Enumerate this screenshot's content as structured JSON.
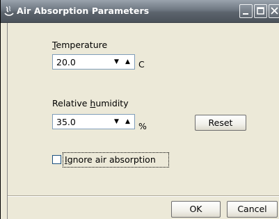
{
  "window": {
    "title": "Air Absorption Parameters",
    "icon": "java-cup-icon",
    "controls": [
      "minimize-icon",
      "maximize-icon",
      "close-icon"
    ]
  },
  "temperature": {
    "label_first": "T",
    "label_rest": "emperature",
    "value": "20.0",
    "unit": "C"
  },
  "humidity": {
    "label_pre": "Relative ",
    "label_mn": "h",
    "label_post": "umidity",
    "value": "35.0",
    "unit": "%"
  },
  "reset_label": "Reset",
  "ignore": {
    "mn": "I",
    "rest": "gnore air absorption",
    "checked": false
  },
  "ok_label": "OK",
  "cancel_label": "Cancel",
  "arrows": {
    "down": "▼",
    "up": "▲"
  },
  "colors": {
    "titlebar": "#6e7781",
    "dialog_bg": "#ece9d8",
    "field_border": "#7f9db9"
  }
}
